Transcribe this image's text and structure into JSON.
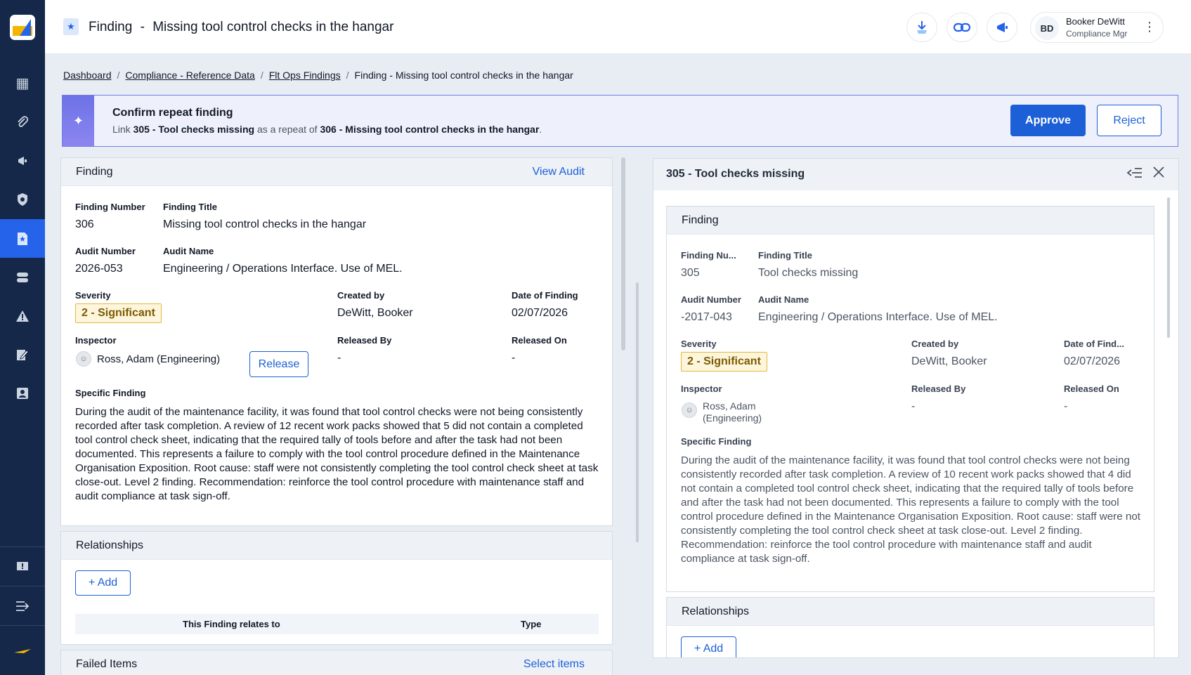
{
  "nav": {
    "items": [
      "dashboard-icon",
      "paperclip-icon",
      "megaphone-icon",
      "shield-icon",
      "findings-icon",
      "database-icon",
      "warning-icon",
      "edit-icon",
      "contacts-icon"
    ],
    "bottom": [
      "feedback-icon",
      "collapse-menu-icon",
      "brand-icon"
    ]
  },
  "header": {
    "title": "Finding",
    "title_sep": "-",
    "subtitle": "Missing tool control checks in the hangar",
    "user_initials": "BD",
    "user_name": "Booker DeWitt",
    "user_role": "Compliance Mgr"
  },
  "breadcrumb": {
    "items": [
      "Dashboard",
      "Compliance - Reference Data",
      "Flt Ops Findings"
    ],
    "current": "Finding - Missing tool control checks in the hangar",
    "sep": "/"
  },
  "banner": {
    "title": "Confirm repeat finding",
    "text_link": "Link",
    "source": "305 - Tool checks missing",
    "text_mid": "as a repeat of",
    "target": "306 - Missing tool control checks in the hangar",
    "text_end": ".",
    "approve_label": "Approve",
    "reject_label": "Reject"
  },
  "finding": {
    "header": "Finding",
    "view_audit": "View Audit",
    "finding_number_label": "Finding Number",
    "finding_number": "306",
    "finding_title_label": "Finding Title",
    "finding_title": "Missing tool control checks in the hangar",
    "audit_number_label": "Audit Number",
    "audit_number": "2026-053",
    "audit_name_label": "Audit Name",
    "audit_name": "Engineering / Operations Interface. Use of MEL.",
    "severity_label": "Severity",
    "severity": "2 - Significant",
    "created_by_label": "Created by",
    "created_by": "DeWitt, Booker",
    "date_label": "Date of Finding",
    "date": "02/07/2026",
    "inspector_label": "Inspector",
    "inspector": "Ross, Adam (Engineering)",
    "release_label": "Release",
    "released_by_label": "Released By",
    "released_by": "-",
    "released_on_label": "Released On",
    "released_on": "-",
    "specific_label": "Specific Finding",
    "specific": "During the audit of the maintenance facility, it was found that tool control checks were not being consistently recorded after task completion. A review of 12 recent work packs showed that 5 did not contain a completed tool control check sheet, indicating that the required tally of tools before and after the task had not been documented. This represents a failure to comply with the tool control procedure defined in the Maintenance Organisation Exposition. Root cause: staff were not consistently completing the tool control check sheet at task close-out. Level 2 finding. Recommendation: reinforce the tool control procedure with maintenance staff and audit compliance at task sign-off."
  },
  "relationships": {
    "header": "Relationships",
    "add_label": "Add",
    "col_relates": "This Finding relates to",
    "col_type": "Type"
  },
  "failed_items": {
    "header": "Failed Items",
    "select_label": "Select items"
  },
  "compare": {
    "title": "305 - Tool checks missing",
    "finding_header": "Finding",
    "finding_number_label": "Finding Nu...",
    "finding_number": "305",
    "finding_title_label": "Finding Title",
    "finding_title": "Tool checks missing",
    "audit_number_label": "Audit Number",
    "audit_number": "-2017-043",
    "audit_name_label": "Audit Name",
    "audit_name": "Engineering / Operations Interface. Use of MEL.",
    "severity_label": "Severity",
    "severity": "2 - Significant",
    "created_by_label": "Created by",
    "created_by": "DeWitt, Booker",
    "date_label": "Date of Find...",
    "date": "02/07/2026",
    "inspector_label": "Inspector",
    "inspector": "Ross, Adam (Engineering)",
    "released_by_label": "Released By",
    "released_by": "-",
    "released_on_label": "Released On",
    "released_on": "-",
    "specific_label": "Specific Finding",
    "specific": "During the audit of the maintenance facility, it was found that tool control checks were not being consistently recorded after task completion. A review of 10 recent work packs showed that 4 did not contain a completed tool control check sheet, indicating that the required tally of tools before and after the task had not been documented. This represents a failure to comply with the tool control procedure defined in the Maintenance Organisation Exposition. Root cause: staff were not consistently completing the tool control check sheet at task close-out. Level 2 finding. Recommendation: reinforce the tool control procedure with maintenance staff and audit compliance at task sign-off.",
    "relationships_header": "Relationships",
    "add_label": "Add"
  },
  "colors": {
    "sidebar": "#16284a",
    "accent": "#1d5fd6",
    "banner_bg": "#eef1fc",
    "badge_bg": "#fdf6dd",
    "badge_border": "#e2b93b"
  }
}
